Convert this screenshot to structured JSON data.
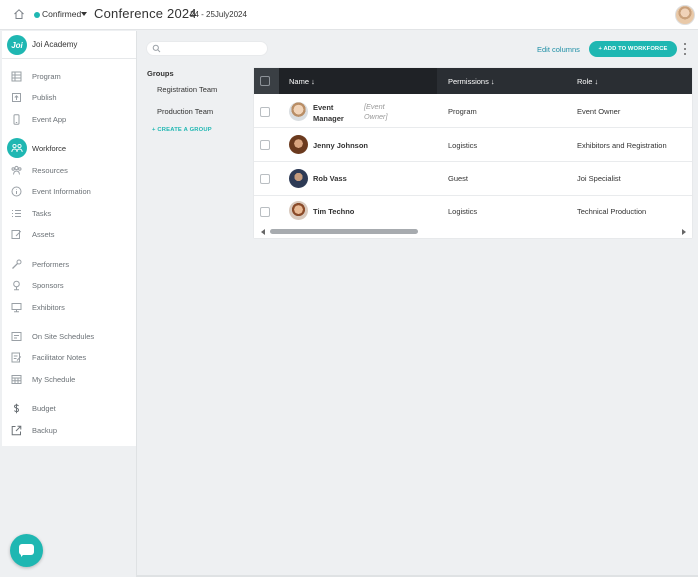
{
  "topbar": {
    "status": "Confirmed",
    "status_color": "#1fb7b2",
    "event_title": "Conference 2024",
    "event_dates": "24 - 25July2024"
  },
  "sidebar": {
    "org_logo": "Joi",
    "org_name": "Joi Academy",
    "items": [
      {
        "label": "Program",
        "icon": "program-icon"
      },
      {
        "label": "Publish",
        "icon": "publish-icon"
      },
      {
        "label": "Event App",
        "icon": "event-app-icon"
      },
      {
        "label": "Workforce",
        "icon": "workforce-icon",
        "active": true
      },
      {
        "label": "Resources",
        "icon": "resources-icon"
      },
      {
        "label": "Event Information",
        "icon": "info-icon"
      },
      {
        "label": "Tasks",
        "icon": "tasks-icon"
      },
      {
        "label": "Assets",
        "icon": "assets-icon"
      },
      {
        "label": "Performers",
        "icon": "microphone-icon"
      },
      {
        "label": "Sponsors",
        "icon": "sponsors-icon"
      },
      {
        "label": "Exhibitors",
        "icon": "exhibitors-icon"
      },
      {
        "label": "On Site Schedules",
        "icon": "onsite-schedules-icon"
      },
      {
        "label": "Facilitator Notes",
        "icon": "notes-icon"
      },
      {
        "label": "My Schedule",
        "icon": "schedule-icon"
      },
      {
        "label": "Budget",
        "icon": "dollar-icon"
      },
      {
        "label": "Backup",
        "icon": "backup-icon"
      }
    ]
  },
  "toolbar": {
    "search_placeholder": "",
    "edit_columns": "Edit columns",
    "add_button": "+ ADD TO WORKFORCE"
  },
  "groups": {
    "title": "Groups",
    "items": [
      "Registration Team",
      "Production Team"
    ],
    "create": "+ CREATE A GROUP"
  },
  "table": {
    "headers": {
      "name": "Name ↓",
      "permissions": "Permissions ↓",
      "role": "Role ↓"
    },
    "rows": [
      {
        "name": "Event Manager",
        "tag": "[Event Owner]",
        "permissions": "Program",
        "role": "Event Owner"
      },
      {
        "name": "Jenny Johnson",
        "tag": "",
        "permissions": "Logistics",
        "role": "Exhibitors and Registration"
      },
      {
        "name": "Rob Vass",
        "tag": "",
        "permissions": "Guest",
        "role": "Joi Specialist"
      },
      {
        "name": "Tim Techno",
        "tag": "",
        "permissions": "Logistics",
        "role": "Technical Production"
      }
    ]
  }
}
